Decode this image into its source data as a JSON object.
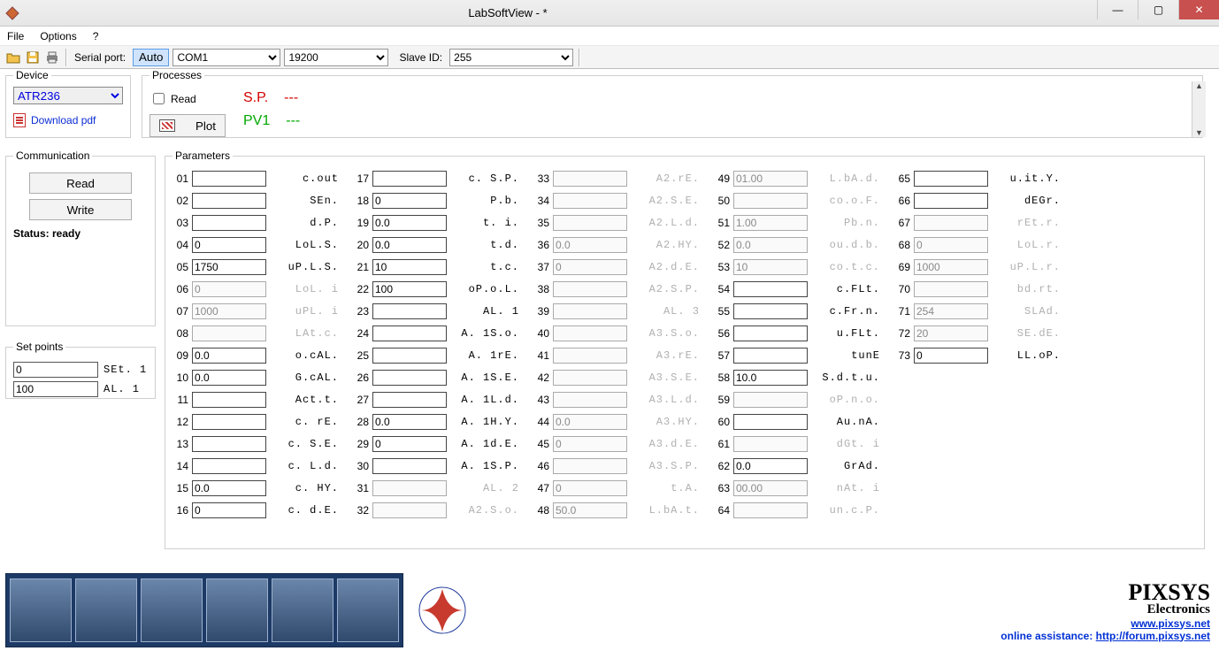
{
  "window": {
    "title": "LabSoftView -  *"
  },
  "menu": {
    "file": "File",
    "options": "Options",
    "help": "?"
  },
  "toolbar": {
    "serial_port_label": "Serial port:",
    "auto": "Auto",
    "port": "COM1",
    "baud": "19200",
    "slave_id_label": "Slave ID:",
    "slave_id": "255"
  },
  "device": {
    "legend": "Device",
    "selected": "ATR236",
    "download_pdf": "Download pdf"
  },
  "processes": {
    "legend": "Processes",
    "read_label": "Read",
    "plot_label": "Plot",
    "sp_label": "S.P.",
    "sp_value": "---",
    "pv1_label": "PV1",
    "pv1_value": "---"
  },
  "communication": {
    "legend": "Communication",
    "read": "Read",
    "write": "Write",
    "status_label": "Status: ready"
  },
  "setpoints": {
    "legend": "Set points",
    "rows": [
      {
        "value": "0",
        "label": "SEt. 1"
      },
      {
        "value": "100",
        "label": "AL.  1"
      }
    ]
  },
  "parameters": {
    "legend": "Parameters",
    "items": [
      {
        "n": "01",
        "v": "",
        "lbl": "c.out",
        "dim": false
      },
      {
        "n": "02",
        "v": "",
        "lbl": "SEn.",
        "dim": false
      },
      {
        "n": "03",
        "v": "",
        "lbl": "d.P.",
        "dim": false
      },
      {
        "n": "04",
        "v": "0",
        "lbl": "LoL.S.",
        "dim": false
      },
      {
        "n": "05",
        "v": "1750",
        "lbl": "uP.L.S.",
        "dim": false
      },
      {
        "n": "06",
        "v": "0",
        "lbl": "LoL. i",
        "dim": true
      },
      {
        "n": "07",
        "v": "1000",
        "lbl": "uPL. i",
        "dim": true
      },
      {
        "n": "08",
        "v": "",
        "lbl": "LAt.c.",
        "dim": true
      },
      {
        "n": "09",
        "v": "0.0",
        "lbl": "o.cAL.",
        "dim": false
      },
      {
        "n": "10",
        "v": "0.0",
        "lbl": "G.cAL.",
        "dim": false
      },
      {
        "n": "11",
        "v": "",
        "lbl": "Act.t.",
        "dim": false
      },
      {
        "n": "12",
        "v": "",
        "lbl": "c. rE.",
        "dim": false
      },
      {
        "n": "13",
        "v": "",
        "lbl": "c. S.E.",
        "dim": false
      },
      {
        "n": "14",
        "v": "",
        "lbl": "c. L.d.",
        "dim": false
      },
      {
        "n": "15",
        "v": "0.0",
        "lbl": "c. HY.",
        "dim": false
      },
      {
        "n": "16",
        "v": "0",
        "lbl": "c. d.E.",
        "dim": false
      },
      {
        "n": "17",
        "v": "",
        "lbl": "c. S.P.",
        "dim": false
      },
      {
        "n": "18",
        "v": "0",
        "lbl": "P.b.",
        "dim": false
      },
      {
        "n": "19",
        "v": "0.0",
        "lbl": "t. i.",
        "dim": false
      },
      {
        "n": "20",
        "v": "0.0",
        "lbl": "t.d.",
        "dim": false
      },
      {
        "n": "21",
        "v": "10",
        "lbl": "t.c.",
        "dim": false
      },
      {
        "n": "22",
        "v": "100",
        "lbl": "oP.o.L.",
        "dim": false
      },
      {
        "n": "23",
        "v": "",
        "lbl": "AL.  1",
        "dim": false
      },
      {
        "n": "24",
        "v": "",
        "lbl": "A. 1S.o.",
        "dim": false
      },
      {
        "n": "25",
        "v": "",
        "lbl": "A. 1rE.",
        "dim": false
      },
      {
        "n": "26",
        "v": "",
        "lbl": "A. 1S.E.",
        "dim": false
      },
      {
        "n": "27",
        "v": "",
        "lbl": "A. 1L.d.",
        "dim": false
      },
      {
        "n": "28",
        "v": "0.0",
        "lbl": "A. 1H.Y.",
        "dim": false
      },
      {
        "n": "29",
        "v": "0",
        "lbl": "A. 1d.E.",
        "dim": false
      },
      {
        "n": "30",
        "v": "",
        "lbl": "A. 1S.P.",
        "dim": false
      },
      {
        "n": "31",
        "v": "",
        "lbl": "AL.  2",
        "dim": true
      },
      {
        "n": "32",
        "v": "",
        "lbl": "A2.S.o.",
        "dim": true
      },
      {
        "n": "33",
        "v": "",
        "lbl": "A2.rE.",
        "dim": true
      },
      {
        "n": "34",
        "v": "",
        "lbl": "A2.S.E.",
        "dim": true
      },
      {
        "n": "35",
        "v": "",
        "lbl": "A2.L.d.",
        "dim": true
      },
      {
        "n": "36",
        "v": "0.0",
        "lbl": "A2.HY.",
        "dim": true
      },
      {
        "n": "37",
        "v": "0",
        "lbl": "A2.d.E.",
        "dim": true
      },
      {
        "n": "38",
        "v": "",
        "lbl": "A2.S.P.",
        "dim": true
      },
      {
        "n": "39",
        "v": "",
        "lbl": "AL.  3",
        "dim": true
      },
      {
        "n": "40",
        "v": "",
        "lbl": "A3.S.o.",
        "dim": true
      },
      {
        "n": "41",
        "v": "",
        "lbl": "A3.rE.",
        "dim": true
      },
      {
        "n": "42",
        "v": "",
        "lbl": "A3.S.E.",
        "dim": true
      },
      {
        "n": "43",
        "v": "",
        "lbl": "A3.L.d.",
        "dim": true
      },
      {
        "n": "44",
        "v": "0.0",
        "lbl": "A3.HY.",
        "dim": true
      },
      {
        "n": "45",
        "v": "0",
        "lbl": "A3.d.E.",
        "dim": true
      },
      {
        "n": "46",
        "v": "",
        "lbl": "A3.S.P.",
        "dim": true
      },
      {
        "n": "47",
        "v": "0",
        "lbl": "t.A.",
        "dim": true
      },
      {
        "n": "48",
        "v": "50.0",
        "lbl": "L.bA.t.",
        "dim": true
      },
      {
        "n": "49",
        "v": "01.00",
        "lbl": "L.bA.d.",
        "dim": true
      },
      {
        "n": "50",
        "v": "",
        "lbl": "co.o.F.",
        "dim": true
      },
      {
        "n": "51",
        "v": "1.00",
        "lbl": "Pb.n.",
        "dim": true
      },
      {
        "n": "52",
        "v": "0.0",
        "lbl": "ou.d.b.",
        "dim": true
      },
      {
        "n": "53",
        "v": "10",
        "lbl": "co.t.c.",
        "dim": true
      },
      {
        "n": "54",
        "v": "",
        "lbl": "c.FLt.",
        "dim": false
      },
      {
        "n": "55",
        "v": "",
        "lbl": "c.Fr.n.",
        "dim": false
      },
      {
        "n": "56",
        "v": "",
        "lbl": "u.FLt.",
        "dim": false
      },
      {
        "n": "57",
        "v": "",
        "lbl": "tunE",
        "dim": false
      },
      {
        "n": "58",
        "v": "10.0",
        "lbl": "S.d.t.u.",
        "dim": false
      },
      {
        "n": "59",
        "v": "",
        "lbl": "oP.n.o.",
        "dim": true
      },
      {
        "n": "60",
        "v": "",
        "lbl": "Au.nA.",
        "dim": false
      },
      {
        "n": "61",
        "v": "",
        "lbl": "dGt. i",
        "dim": true
      },
      {
        "n": "62",
        "v": "0.0",
        "lbl": "GrAd.",
        "dim": false
      },
      {
        "n": "63",
        "v": "00.00",
        "lbl": "nAt. i",
        "dim": true
      },
      {
        "n": "64",
        "v": "",
        "lbl": "un.c.P.",
        "dim": true
      },
      {
        "n": "65",
        "v": "",
        "lbl": "u.it.Y.",
        "dim": false
      },
      {
        "n": "66",
        "v": "",
        "lbl": "dEGr.",
        "dim": false
      },
      {
        "n": "67",
        "v": "",
        "lbl": "rEt.r.",
        "dim": true
      },
      {
        "n": "68",
        "v": "0",
        "lbl": "LoL.r.",
        "dim": true
      },
      {
        "n": "69",
        "v": "1000",
        "lbl": "uP.L.r.",
        "dim": true
      },
      {
        "n": "70",
        "v": "",
        "lbl": "bd.rt.",
        "dim": true
      },
      {
        "n": "71",
        "v": "254",
        "lbl": "SLAd.",
        "dim": true
      },
      {
        "n": "72",
        "v": "20",
        "lbl": "SE.dE.",
        "dim": true
      },
      {
        "n": "73",
        "v": "0",
        "lbl": "LL.oP.",
        "dim": false
      }
    ]
  },
  "footer": {
    "company": "PIXSYS",
    "subtitle": "Electronics",
    "website": "www.pixsys.net",
    "assist_label": "online assistance: ",
    "assist_url": "http://forum.pixsys.net"
  }
}
